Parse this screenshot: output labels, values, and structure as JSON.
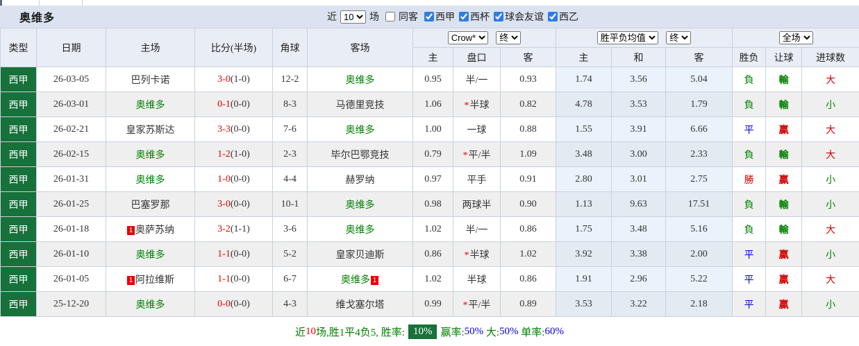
{
  "title": "奥维多",
  "topbar": {
    "recent_label": "近",
    "recent_value": "10",
    "matches_label": "场",
    "same_away_label": "同客",
    "same_away_checked": false,
    "leagues": [
      {
        "label": "西甲",
        "checked": true
      },
      {
        "label": "西杯",
        "checked": true
      },
      {
        "label": "球会友谊",
        "checked": true
      },
      {
        "label": "西乙",
        "checked": true
      }
    ]
  },
  "controls": {
    "bookmaker_select": "Crow*",
    "bookmaker_time_select": "终",
    "avg_select": "胜平负均值",
    "avg_time_select": "终",
    "scope_select": "全场"
  },
  "columns": {
    "type": "类型",
    "date": "日期",
    "home": "主场",
    "score": "比分(半场)",
    "corner": "角球",
    "away": "客场",
    "odds_home": "主",
    "odds_line": "盘口",
    "odds_away": "客",
    "avg_home": "主",
    "avg_draw": "和",
    "avg_away": "客",
    "result_wdl": "胜负",
    "result_handicap": "让球",
    "result_goals": "进球数"
  },
  "rows": [
    {
      "league": "西甲",
      "date": "26-03-05",
      "home": {
        "name": "巴列卡诺",
        "hl": false,
        "rc": null
      },
      "score": "3-0",
      "half": "(1-0)",
      "corner": "12-2",
      "away": {
        "name": "奥维多",
        "hl": true,
        "rc": null
      },
      "odds": {
        "h": "0.95",
        "line": "半/一",
        "star": false,
        "a": "0.93"
      },
      "avg": {
        "h": "1.74",
        "d": "3.56",
        "a": "5.04"
      },
      "res": {
        "w": [
          "負",
          "tg"
        ],
        "h": [
          "輸",
          "tg"
        ],
        "g": [
          "大",
          "tr"
        ]
      }
    },
    {
      "league": "西甲",
      "date": "26-03-01",
      "home": {
        "name": "奥维多",
        "hl": true,
        "rc": null
      },
      "score": "0-1",
      "half": "(0-0)",
      "corner": "8-3",
      "away": {
        "name": "马德里竞技",
        "hl": false,
        "rc": null
      },
      "odds": {
        "h": "1.06",
        "line": "半球",
        "star": true,
        "a": "0.82"
      },
      "avg": {
        "h": "4.78",
        "d": "3.53",
        "a": "1.79"
      },
      "res": {
        "w": [
          "負",
          "tg"
        ],
        "h": [
          "輸",
          "tg"
        ],
        "g": [
          "小",
          "tg"
        ]
      }
    },
    {
      "league": "西甲",
      "date": "26-02-21",
      "home": {
        "name": "皇家苏斯达",
        "hl": false,
        "rc": null
      },
      "score": "3-3",
      "half": "(0-0)",
      "corner": "7-6",
      "away": {
        "name": "奥维多",
        "hl": true,
        "rc": null
      },
      "odds": {
        "h": "1.00",
        "line": "一球",
        "star": false,
        "a": "0.88"
      },
      "avg": {
        "h": "1.55",
        "d": "3.91",
        "a": "6.66"
      },
      "res": {
        "w": [
          "平",
          "tb"
        ],
        "h": [
          "贏",
          "tr"
        ],
        "g": [
          "大",
          "tr"
        ]
      }
    },
    {
      "league": "西甲",
      "date": "26-02-15",
      "home": {
        "name": "奥维多",
        "hl": true,
        "rc": null
      },
      "score": "1-2",
      "half": "(1-0)",
      "corner": "2-3",
      "away": {
        "name": "毕尔巴鄂竞技",
        "hl": false,
        "rc": null
      },
      "odds": {
        "h": "0.79",
        "line": "平/半",
        "star": true,
        "a": "1.09"
      },
      "avg": {
        "h": "3.48",
        "d": "3.00",
        "a": "2.33"
      },
      "res": {
        "w": [
          "負",
          "tg"
        ],
        "h": [
          "輸",
          "tg"
        ],
        "g": [
          "大",
          "tr"
        ]
      }
    },
    {
      "league": "西甲",
      "date": "26-01-31",
      "home": {
        "name": "奥维多",
        "hl": true,
        "rc": null
      },
      "score": "1-0",
      "half": "(0-0)",
      "corner": "4-4",
      "away": {
        "name": "赫罗纳",
        "hl": false,
        "rc": null
      },
      "odds": {
        "h": "0.97",
        "line": "平手",
        "star": false,
        "a": "0.91"
      },
      "avg": {
        "h": "2.80",
        "d": "3.01",
        "a": "2.75"
      },
      "res": {
        "w": [
          "勝",
          "tr"
        ],
        "h": [
          "贏",
          "tr"
        ],
        "g": [
          "小",
          "tg"
        ]
      }
    },
    {
      "league": "西甲",
      "date": "26-01-25",
      "home": {
        "name": "巴塞罗那",
        "hl": false,
        "rc": null
      },
      "score": "3-0",
      "half": "(0-0)",
      "corner": "10-1",
      "away": {
        "name": "奥维多",
        "hl": true,
        "rc": null
      },
      "odds": {
        "h": "0.98",
        "line": "两球半",
        "star": false,
        "a": "0.90"
      },
      "avg": {
        "h": "1.13",
        "d": "9.63",
        "a": "17.51"
      },
      "res": {
        "w": [
          "負",
          "tg"
        ],
        "h": [
          "輸",
          "tg"
        ],
        "g": [
          "小",
          "tg"
        ]
      }
    },
    {
      "league": "西甲",
      "date": "26-01-18",
      "home": {
        "name": "奥萨苏纳",
        "hl": false,
        "rc": "before"
      },
      "score": "3-2",
      "half": "(1-1)",
      "corner": "3-6",
      "away": {
        "name": "奥维多",
        "hl": true,
        "rc": null
      },
      "odds": {
        "h": "1.02",
        "line": "半/一",
        "star": false,
        "a": "0.86"
      },
      "avg": {
        "h": "1.75",
        "d": "3.48",
        "a": "5.16"
      },
      "res": {
        "w": [
          "負",
          "tg"
        ],
        "h": [
          "輸",
          "tg"
        ],
        "g": [
          "大",
          "tr"
        ]
      }
    },
    {
      "league": "西甲",
      "date": "26-01-10",
      "home": {
        "name": "奥维多",
        "hl": true,
        "rc": null
      },
      "score": "1-1",
      "half": "(0-0)",
      "corner": "5-2",
      "away": {
        "name": "皇家贝迪斯",
        "hl": false,
        "rc": null
      },
      "odds": {
        "h": "0.86",
        "line": "半球",
        "star": true,
        "a": "1.02"
      },
      "avg": {
        "h": "3.92",
        "d": "3.38",
        "a": "2.00"
      },
      "res": {
        "w": [
          "平",
          "tb"
        ],
        "h": [
          "贏",
          "tr"
        ],
        "g": [
          "小",
          "tg"
        ]
      }
    },
    {
      "league": "西甲",
      "date": "26-01-05",
      "home": {
        "name": "阿拉维斯",
        "hl": false,
        "rc": "before"
      },
      "score": "1-1",
      "half": "(0-0)",
      "corner": "6-7",
      "away": {
        "name": "奥维多",
        "hl": true,
        "rc": "after"
      },
      "odds": {
        "h": "1.02",
        "line": "半球",
        "star": false,
        "a": "0.86"
      },
      "avg": {
        "h": "1.91",
        "d": "2.96",
        "a": "5.22"
      },
      "res": {
        "w": [
          "平",
          "tb"
        ],
        "h": [
          "贏",
          "tr"
        ],
        "g": [
          "大",
          "tr"
        ]
      }
    },
    {
      "league": "西甲",
      "date": "25-12-20",
      "home": {
        "name": "奥维多",
        "hl": true,
        "rc": null
      },
      "score": "0-0",
      "half": "(0-0)",
      "corner": "4-3",
      "away": {
        "name": "维戈塞尔塔",
        "hl": false,
        "rc": null
      },
      "odds": {
        "h": "0.99",
        "line": "平/半",
        "star": true,
        "a": "0.89"
      },
      "avg": {
        "h": "3.53",
        "d": "3.22",
        "a": "2.18"
      },
      "res": {
        "w": [
          "平",
          "tb"
        ],
        "h": [
          "贏",
          "tr"
        ],
        "g": [
          "小",
          "tg"
        ]
      }
    }
  ],
  "footer": {
    "segments": [
      {
        "text": "近",
        "color": "green"
      },
      {
        "text": "10",
        "color": "red"
      },
      {
        "text": "场,胜1平4负5, 胜率:",
        "color": "green"
      },
      {
        "text": "10%",
        "badge": true
      },
      {
        "text": "赢率:",
        "color": "green"
      },
      {
        "text": "50%",
        "color": "blue"
      },
      {
        "text": " 大:",
        "color": "green"
      },
      {
        "text": "50%",
        "color": "blue"
      },
      {
        "text": " 单率:",
        "color": "green"
      },
      {
        "text": "60%",
        "color": "blue"
      }
    ]
  },
  "red_card_badge": "1",
  "colors": {
    "green": "#008000",
    "red": "#d40000",
    "blue": "#0000cc",
    "cell_green": "#17713a",
    "badge_red": "#e60000"
  }
}
